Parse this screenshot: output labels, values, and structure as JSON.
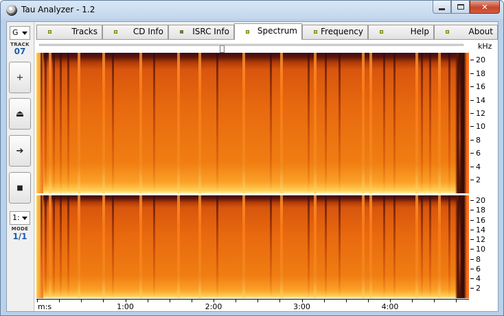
{
  "window": {
    "title": "Tau Analyzer - 1.2"
  },
  "sidebar": {
    "track_select": {
      "value": "G"
    },
    "track_label": "TRACK",
    "track_number": "07",
    "buttons": {
      "add": "+",
      "eject": "⏏",
      "next": "➔",
      "stop": "■"
    },
    "mode_select": {
      "value": "1:"
    },
    "mode_label": "MODE",
    "mode_value": "1/1"
  },
  "tabs": [
    {
      "label": "Tracks",
      "active": false,
      "led_color": "#b5e61d"
    },
    {
      "label": "CD Info",
      "active": false,
      "led_color": "#b5e61d"
    },
    {
      "label": "ISRC Info",
      "active": false,
      "led_color": "#707070"
    },
    {
      "label": "Spectrum",
      "active": true,
      "led_color": "#b5e61d"
    },
    {
      "label": "Frequency",
      "active": false,
      "led_color": "#b5e61d"
    },
    {
      "label": "Help",
      "active": false,
      "led_color": "#b5e61d"
    },
    {
      "label": "About",
      "active": false,
      "led_color": "#b5e61d"
    }
  ],
  "spectrum": {
    "unit_label": "kHz",
    "frequency_ticks": [
      "20",
      "18",
      "16",
      "14",
      "12",
      "10",
      "8",
      "6",
      "4",
      "2"
    ],
    "time_axis_label": "m:s",
    "time_ticks": [
      "1:00",
      "2:00",
      "3:00",
      "4:00"
    ],
    "position_fraction": 0.43
  }
}
